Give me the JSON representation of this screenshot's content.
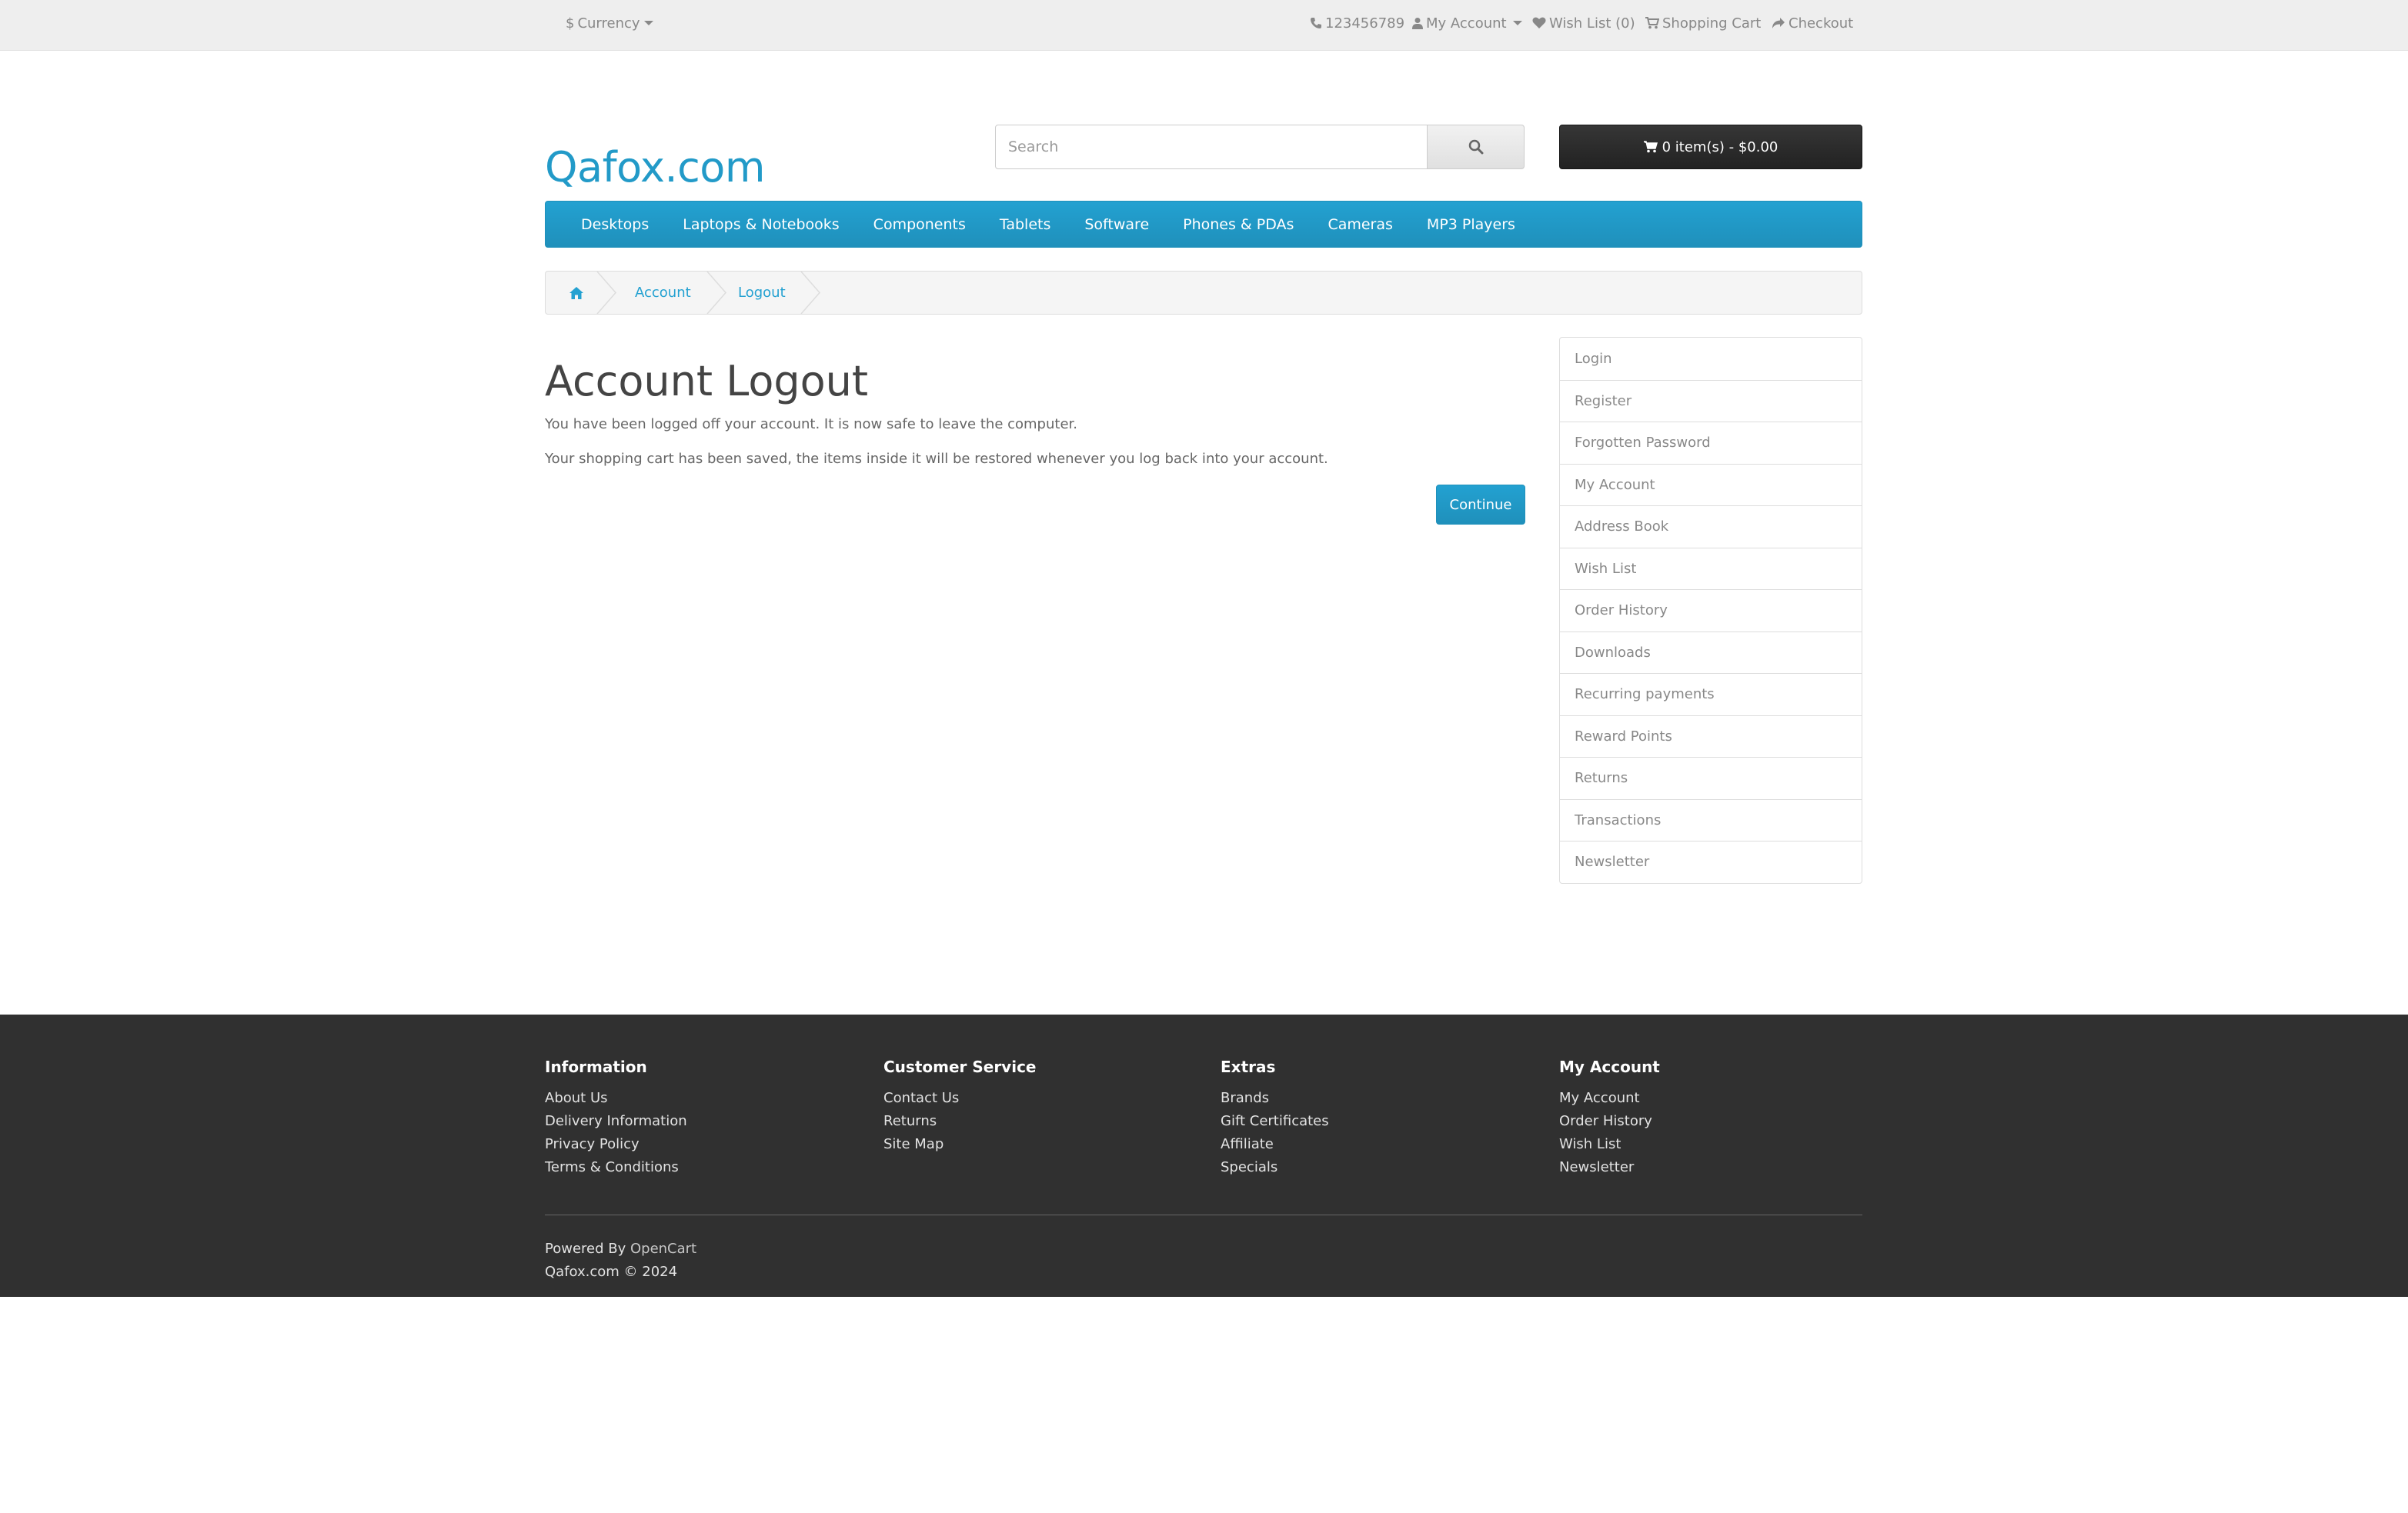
{
  "topbar": {
    "currency_label": "Currency",
    "phone": "123456789",
    "my_account": "My Account",
    "wish_list": "Wish List (0)",
    "shopping_cart": "Shopping Cart",
    "checkout": "Checkout"
  },
  "header": {
    "logo": "Qafox.com",
    "search_placeholder": "Search",
    "cart_label": "0 item(s) - $0.00"
  },
  "menu": {
    "items": [
      "Desktops",
      "Laptops & Notebooks",
      "Components",
      "Tablets",
      "Software",
      "Phones & PDAs",
      "Cameras",
      "MP3 Players"
    ]
  },
  "breadcrumb": {
    "items": [
      "Account",
      "Logout"
    ]
  },
  "main": {
    "title": "Account Logout",
    "para1": "You have been logged off your account. It is now safe to leave the computer.",
    "para2": "Your shopping cart has been saved, the items inside it will be restored whenever you log back into your account.",
    "continue_label": "Continue"
  },
  "sidebar": {
    "items": [
      "Login",
      "Register",
      "Forgotten Password",
      "My Account",
      "Address Book",
      "Wish List",
      "Order History",
      "Downloads",
      "Recurring payments",
      "Reward Points",
      "Returns",
      "Transactions",
      "Newsletter"
    ]
  },
  "footer": {
    "columns": [
      {
        "title": "Information",
        "links": [
          "About Us",
          "Delivery Information",
          "Privacy Policy",
          "Terms & Conditions"
        ]
      },
      {
        "title": "Customer Service",
        "links": [
          "Contact Us",
          "Returns",
          "Site Map"
        ]
      },
      {
        "title": "Extras",
        "links": [
          "Brands",
          "Gift Certificates",
          "Affiliate",
          "Specials"
        ]
      },
      {
        "title": "My Account",
        "links": [
          "My Account",
          "Order History",
          "Wish List",
          "Newsletter"
        ]
      }
    ],
    "powered_prefix": "Powered By",
    "powered_link": "OpenCart",
    "copyright": "Qafox.com © 2024"
  },
  "colors": {
    "accent": "#229ac8",
    "topbar_bg": "#eeeeee",
    "footer_bg": "#303030",
    "cart_bg": "#2a2a2a"
  },
  "icons": [
    "dollar-icon",
    "phone-icon",
    "user-icon",
    "heart-icon",
    "cart-icon",
    "share-icon",
    "search-icon",
    "home-icon"
  ]
}
